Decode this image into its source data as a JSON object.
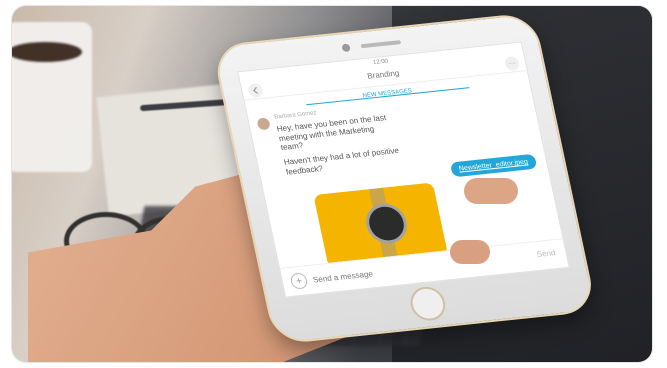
{
  "scene": {
    "colors": {
      "card_bg": "#f4b400",
      "accent": "#22a7d8"
    }
  },
  "phone": {
    "status_time": "12:00",
    "chat": {
      "title": "Branding",
      "divider_label": "NEW MESSAGES",
      "sender_name": "Barbara Gomez",
      "messages": [
        "Hey, have you been on the last meeting with the Marketing team?",
        "Haven't they had a lot of positive feedback?"
      ],
      "link_label": "Newsletter_editor.jpeg",
      "composer_placeholder": "Send a message",
      "send_label": "Send"
    },
    "icons": {
      "back": "back-arrow-icon",
      "menu": "menu-icon",
      "plus": "plus-icon",
      "watch": "watch-icon"
    }
  }
}
